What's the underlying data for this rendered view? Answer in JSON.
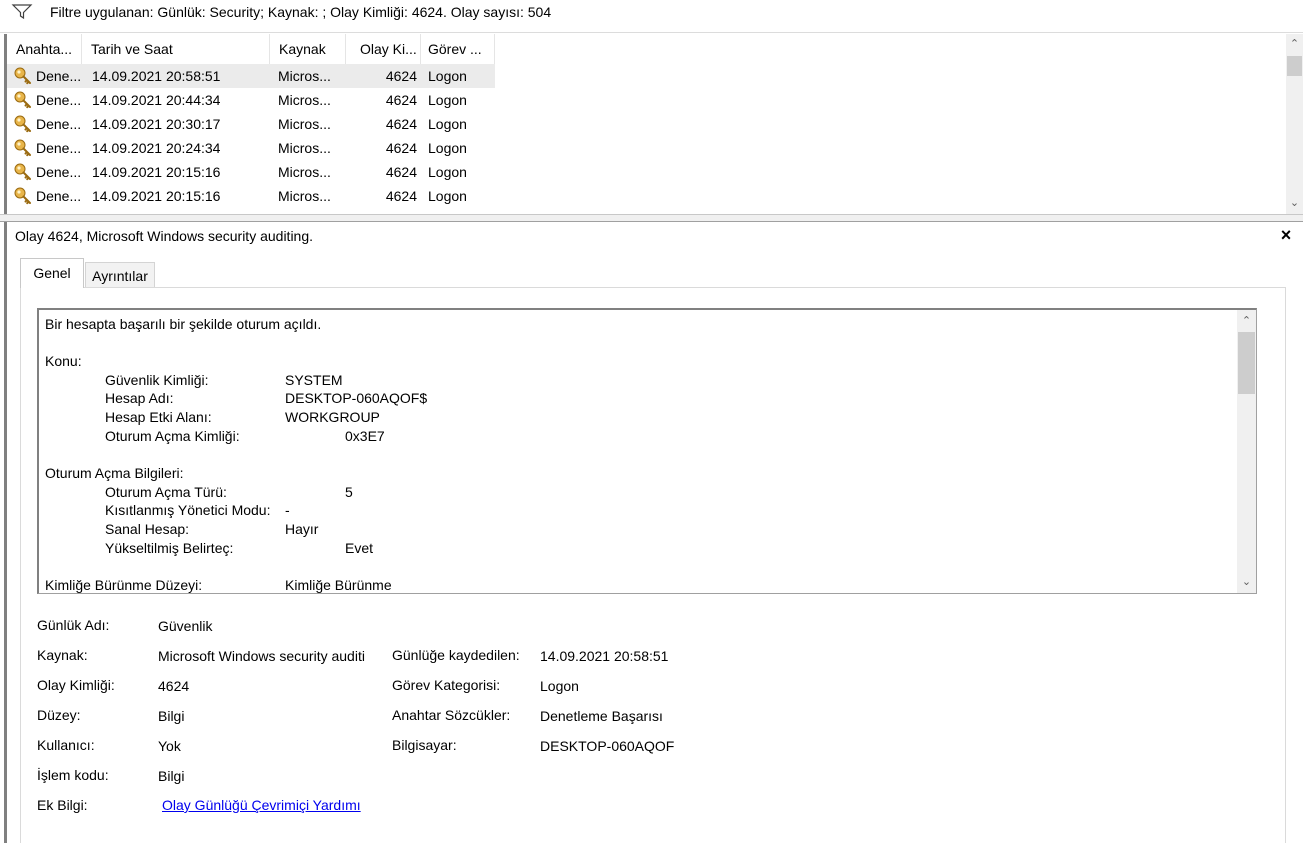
{
  "filter": {
    "icon": "filter-icon",
    "text": "Filtre uygulanan: Günlük: Security; Kaynak: ; Olay Kimliği: 4624. Olay sayısı: 504"
  },
  "list": {
    "columns": [
      "Anahta...",
      "Tarih ve Saat",
      "Kaynak",
      "Olay Ki...",
      "Görev ..."
    ],
    "rows": [
      {
        "icon": "key-icon",
        "keywords": "Dene...",
        "date": "14.09.2021 20:58:51",
        "source": "Micros...",
        "event_id": "4624",
        "task": "Logon"
      },
      {
        "icon": "key-icon",
        "keywords": "Dene...",
        "date": "14.09.2021 20:44:34",
        "source": "Micros...",
        "event_id": "4624",
        "task": "Logon"
      },
      {
        "icon": "key-icon",
        "keywords": "Dene...",
        "date": "14.09.2021 20:30:17",
        "source": "Micros...",
        "event_id": "4624",
        "task": "Logon"
      },
      {
        "icon": "key-icon",
        "keywords": "Dene...",
        "date": "14.09.2021 20:24:34",
        "source": "Micros...",
        "event_id": "4624",
        "task": "Logon"
      },
      {
        "icon": "key-icon",
        "keywords": "Dene...",
        "date": "14.09.2021 20:15:16",
        "source": "Micros...",
        "event_id": "4624",
        "task": "Logon"
      },
      {
        "icon": "key-icon",
        "keywords": "Dene...",
        "date": "14.09.2021 20:15:16",
        "source": "Micros...",
        "event_id": "4624",
        "task": "Logon"
      }
    ],
    "selected_index": 0
  },
  "details": {
    "title": "Olay 4624, Microsoft Windows security auditing.",
    "close_label": "×",
    "tabs": [
      "Genel",
      "Ayrıntılar"
    ],
    "active_tab": "Genel",
    "message": {
      "summary": "Bir hesapta başarılı bir şekilde oturum açıldı.",
      "subject_header": "Konu:",
      "subject": [
        {
          "label": "Güvenlik Kimliği:",
          "value": "SYSTEM"
        },
        {
          "label": "Hesap Adı:",
          "value": "DESKTOP-060AQOF$"
        },
        {
          "label": "Hesap Etki Alanı:",
          "value": "WORKGROUP"
        },
        {
          "label": "Oturum Açma Kimliği:",
          "value": "0x3E7"
        }
      ],
      "logon_header": "Oturum Açma Bilgileri:",
      "logon": [
        {
          "label": "Oturum Açma Türü:",
          "value": "5"
        },
        {
          "label": "Kısıtlanmış Yönetici Modu:",
          "value": "-"
        },
        {
          "label": "Sanal Hesap:",
          "value": "Hayır"
        },
        {
          "label": "Yükseltilmiş Belirteç:",
          "value": "Evet"
        }
      ],
      "impersonation": {
        "label": "Kimliğe Bürünme Düzeyi:",
        "value": "Kimliğe Bürünme"
      }
    },
    "props": {
      "log_name": {
        "label": "Günlük Adı:",
        "value": "Güvenlik"
      },
      "source": {
        "label": "Kaynak:",
        "value": "Microsoft Windows security auditi"
      },
      "event_id": {
        "label": "Olay Kimliği:",
        "value": "4624"
      },
      "level": {
        "label": "Düzey:",
        "value": "Bilgi"
      },
      "user": {
        "label": "Kullanıcı:",
        "value": "Yok"
      },
      "opcode": {
        "label": "İşlem kodu:",
        "value": "Bilgi"
      },
      "more_info": {
        "label": "Ek Bilgi:",
        "link": "Olay Günlüğü Çevrimiçi Yardımı"
      },
      "logged": {
        "label": "Günlüğe kaydedilen:",
        "value": "14.09.2021 20:58:51"
      },
      "task_category": {
        "label": "Görev Kategorisi:",
        "value": "Logon"
      },
      "keywords": {
        "label": "Anahtar Sözcükler:",
        "value": "Denetleme Başarısı"
      },
      "computer": {
        "label": "Bilgisayar:",
        "value": "DESKTOP-060AQOF"
      }
    }
  }
}
